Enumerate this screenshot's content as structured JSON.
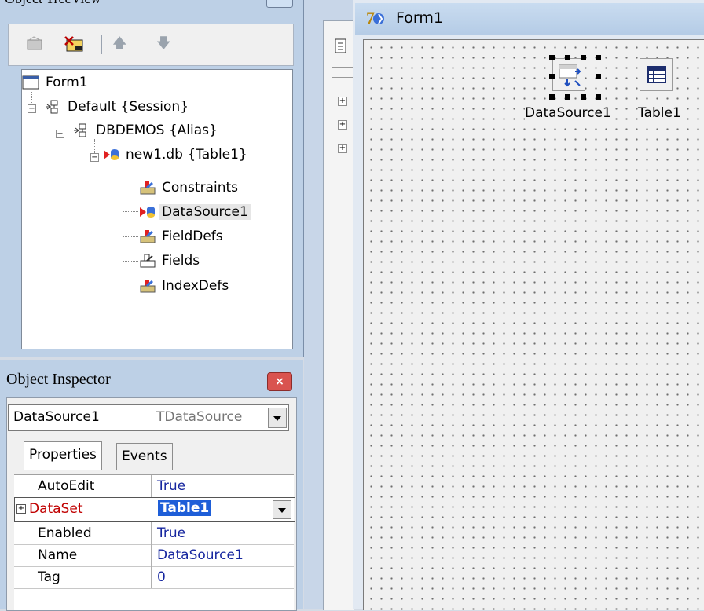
{
  "tree_view": {
    "title": "Object TreeView",
    "nodes": [
      {
        "label": "Form1"
      },
      {
        "label": "Default {Session}"
      },
      {
        "label": "DBDEMOS {Alias}"
      },
      {
        "label": "new1.db {Table1}"
      },
      {
        "label": "Constraints"
      },
      {
        "label": "DataSource1"
      },
      {
        "label": "FieldDefs"
      },
      {
        "label": "Fields"
      },
      {
        "label": "IndexDefs"
      }
    ]
  },
  "inspector": {
    "title": "Object Inspector",
    "component_name": "DataSource1",
    "component_type": "TDataSource",
    "tabs": [
      "Properties",
      "Events"
    ],
    "properties": [
      {
        "name": "AutoEdit",
        "value": "True"
      },
      {
        "name": "DataSet",
        "value": "Table1"
      },
      {
        "name": "Enabled",
        "value": "True"
      },
      {
        "name": "Name",
        "value": "DataSource1"
      },
      {
        "name": "Tag",
        "value": "0"
      }
    ]
  },
  "form": {
    "caption": "Form1",
    "components": [
      {
        "label": "DataSource1"
      },
      {
        "label": "Table1"
      }
    ]
  },
  "colors": {
    "accent": "#0a246a",
    "property_value": "#16269f",
    "dataset_label": "#c00000"
  }
}
